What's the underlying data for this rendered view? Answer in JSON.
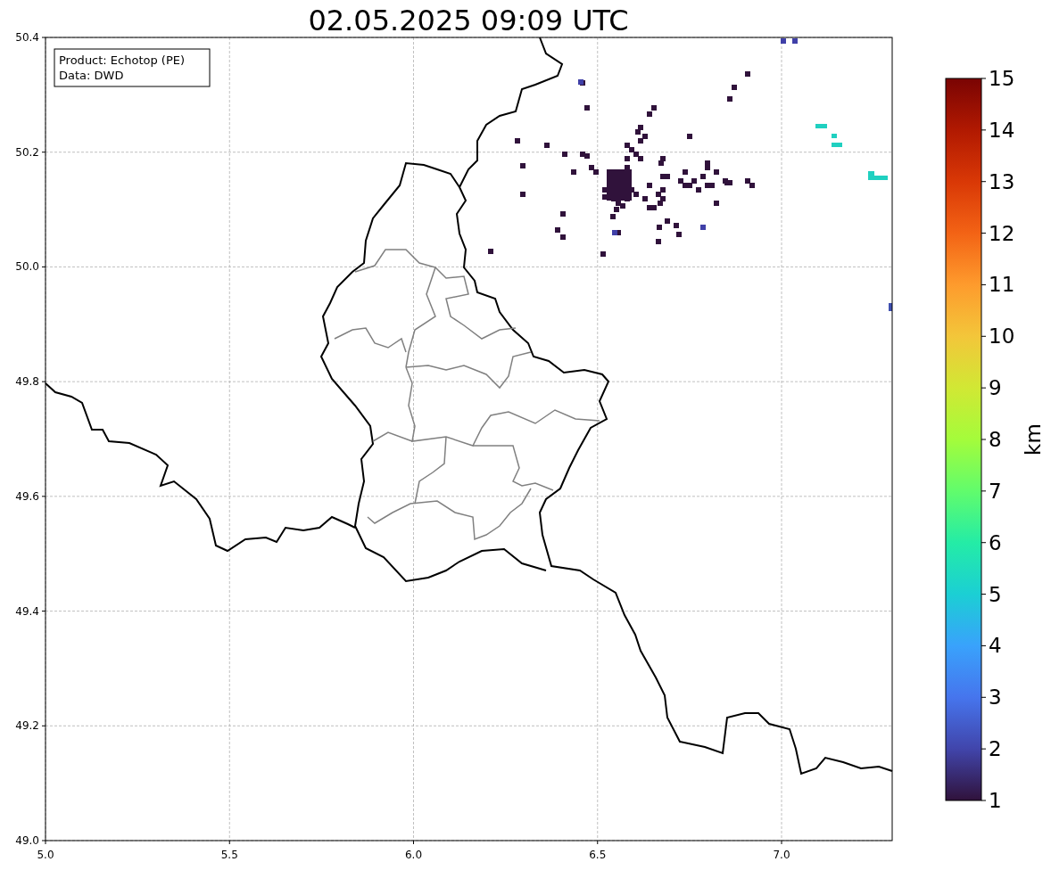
{
  "title": "02.05.2025 09:09 UTC",
  "info_box": {
    "lines": [
      "Product: Echotop (PE)",
      "Data: DWD"
    ]
  },
  "map": {
    "xticks": [
      "5.0",
      "5.5",
      "6.0",
      "6.5",
      "7.0"
    ],
    "yticks": [
      "50.4",
      "50.2",
      "50.0",
      "49.8",
      "49.6",
      "49.4",
      "49.2",
      "49.0"
    ]
  },
  "colorbar": {
    "ticks": [
      "15",
      "14",
      "13",
      "12",
      "11",
      "10",
      "9",
      "8",
      "7",
      "6",
      "5",
      "4",
      "3",
      "2",
      "1"
    ],
    "label": "km"
  }
}
